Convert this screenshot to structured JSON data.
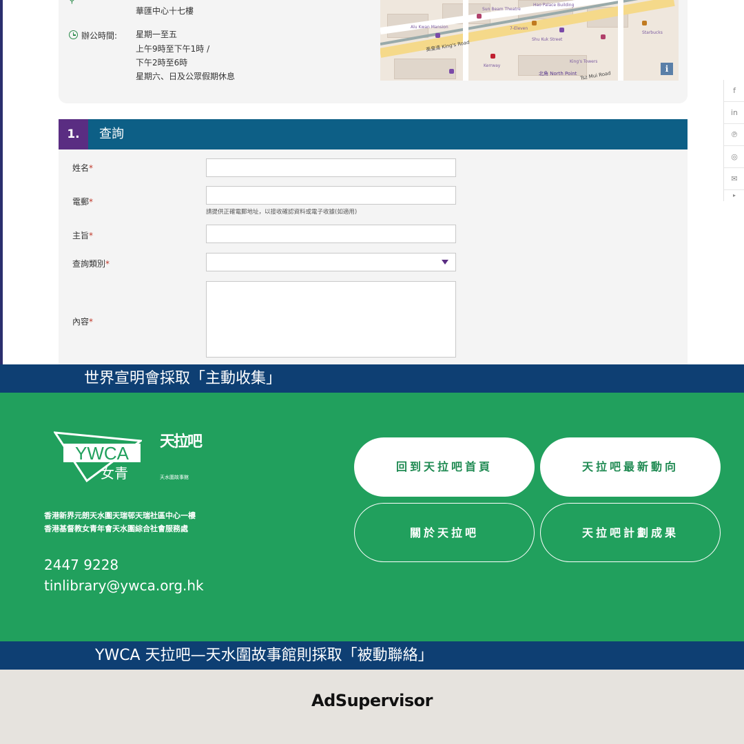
{
  "contact": {
    "address_line": "華匯中心十七樓",
    "hours_label": "辦公時間:",
    "hours_lines": [
      "星期一至五",
      "上午9時至下午1時 /",
      "下午2時至6時",
      "星期六、日及公眾假期休息"
    ]
  },
  "map": {
    "labels": [
      "Sun Beam Theatre",
      "Hao Palace Building",
      "Alu Kwan Mansion",
      "King's Road",
      "英皇道 King's Road",
      "Kerrway",
      "Shu Kuk Street",
      "北角 North Point",
      "Starbucks",
      "King's Towers",
      "Tsz Mui Road",
      "7-Eleven"
    ],
    "info_button": "i"
  },
  "section": {
    "number": "1.",
    "title": "查詢"
  },
  "form": {
    "name_label": "姓名",
    "email_label": "電郵",
    "email_hint": "請提供正確電郵地址，以接收確認資料或電子收據(如適用)",
    "subject_label": "主旨",
    "category_label": "查詢類別",
    "content_label": "內容",
    "required_mark": "*"
  },
  "share": {
    "items": [
      "f",
      "in",
      "℗",
      "◎",
      "✉",
      "▸"
    ]
  },
  "banner_top": "世界宣明會採取「主動收集」",
  "footer": {
    "logo_text": "YWCA",
    "logo_sub": "女青",
    "brand_main": "天拉吧",
    "brand_sub": "天水圍故事館",
    "address_lines": [
      "香港新界元朗天水圍天瑞邨天瑞社區中心一樓",
      "香港基督教女青年會天水圍綜合社會服務處"
    ],
    "phone": "2447 9228",
    "email": "tinlibrary@ywca.org.hk",
    "buttons": [
      "回到天拉吧首頁",
      "天拉吧最新動向",
      "關於天拉吧",
      "天拉吧計劃成果"
    ]
  },
  "banner_bottom": "YWCA 天拉吧—天水圍故事館則採取「被動聯絡」",
  "brand_watermark": "AdSupervisor",
  "colors": {
    "banner": "#0e3f73",
    "footer_green": "#21a05d",
    "section_bar": "#0d5f86",
    "section_num": "#5a2d82"
  }
}
